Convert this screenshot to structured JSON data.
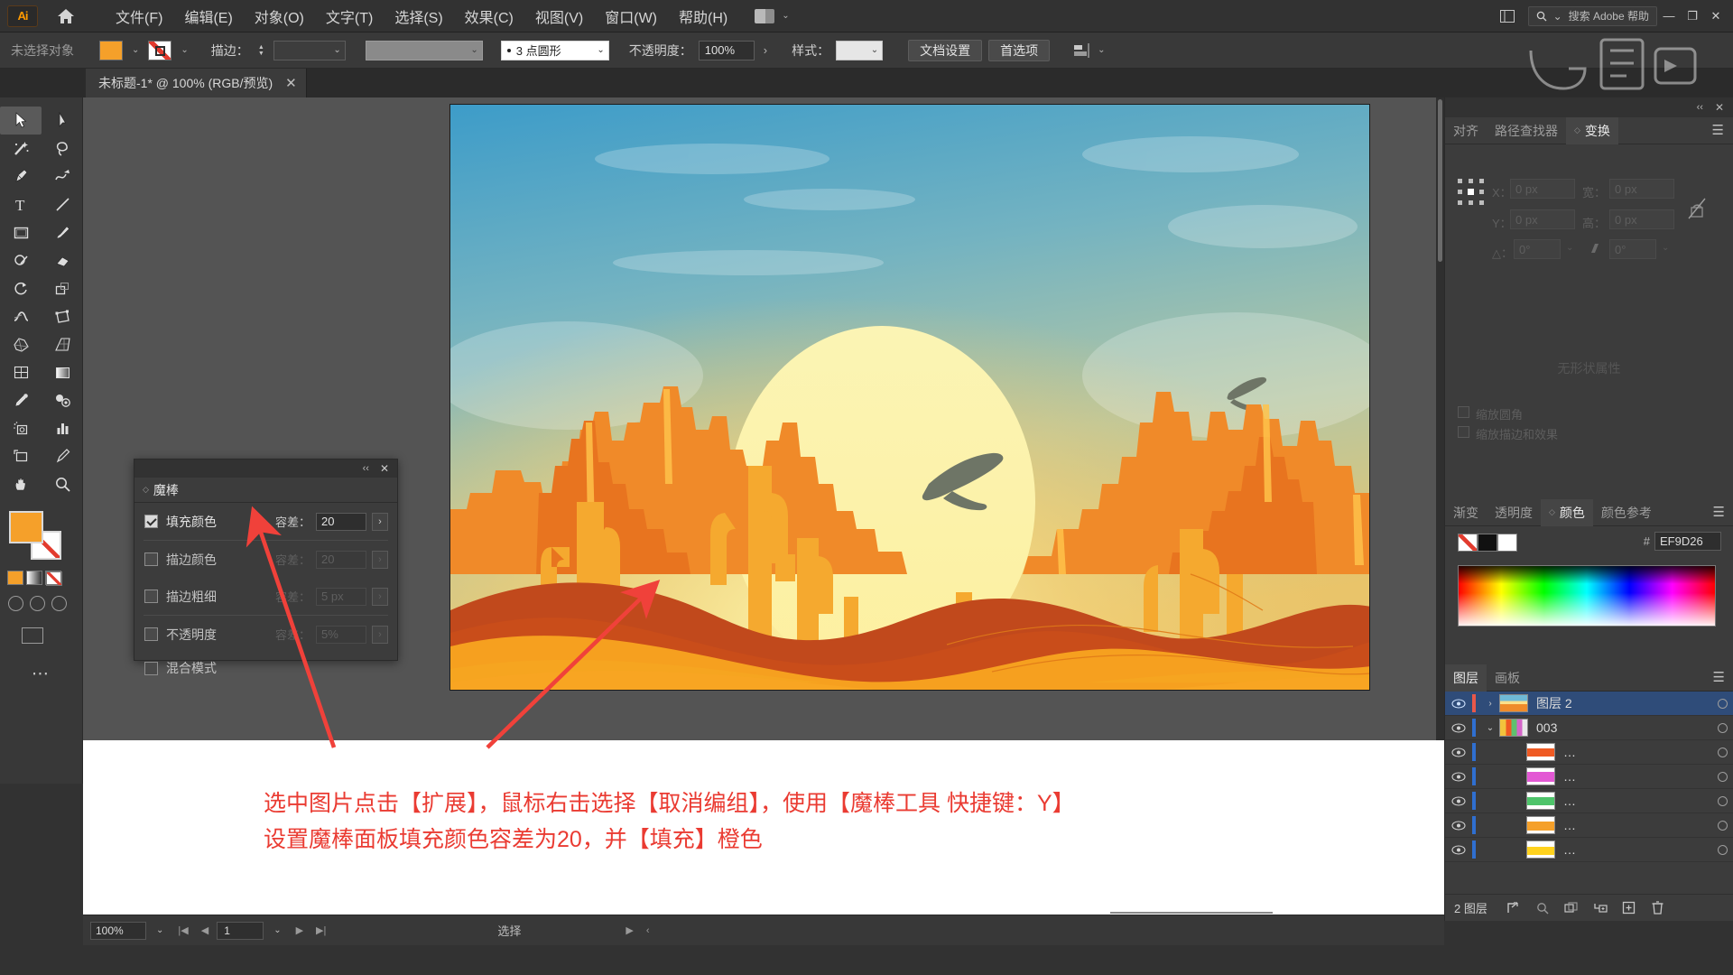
{
  "app": {
    "logo_text": "Ai",
    "menus": [
      "文件(F)",
      "编辑(E)",
      "对象(O)",
      "文字(T)",
      "选择(S)",
      "效果(C)",
      "视图(V)",
      "窗口(W)",
      "帮助(H)"
    ],
    "search_placeholder": "搜索 Adobe 帮助",
    "window_buttons": [
      "—",
      "❐",
      "✕"
    ]
  },
  "options_bar": {
    "selection_status": "未选择对象",
    "fill_color": "#F5A02A",
    "stroke_label": "描边：",
    "stroke_weight": "",
    "brush_profile": "3 点圆形",
    "opacity_label": "不透明度：",
    "opacity_value": "100%",
    "style_label": "样式：",
    "doc_setup_button": "文档设置",
    "preferences_button": "首选项"
  },
  "document_tab": {
    "title": "未标题-1* @ 100% (RGB/预览)",
    "close": "✕"
  },
  "toolbar": {
    "tools": [
      "selection-tool",
      "direct-selection-tool",
      "magic-wand-tool",
      "lasso-tool",
      "pen-tool",
      "curvature-tool",
      "type-tool",
      "line-tool",
      "rectangle-tool",
      "paintbrush-tool",
      "shaper-tool",
      "eraser-tool",
      "rotate-tool",
      "scale-tool",
      "width-tool",
      "free-transform-tool",
      "shape-builder-tool",
      "perspective-grid-tool",
      "mesh-tool",
      "gradient-tool",
      "eyedropper-tool",
      "blend-tool",
      "symbol-sprayer-tool",
      "column-graph-tool",
      "artboard-tool",
      "slice-tool",
      "hand-tool",
      "zoom-tool"
    ],
    "more_tools": "⋯"
  },
  "magic_wand_panel": {
    "panel_title": "魔棒",
    "tolerance_label": "容差：",
    "rows": [
      {
        "label": "填充颜色",
        "checked": true,
        "tolerance": "20",
        "enabled": true
      },
      {
        "label": "描边颜色",
        "checked": false,
        "tolerance": "20",
        "enabled": false
      },
      {
        "label": "描边粗细",
        "checked": false,
        "tolerance": "5 px",
        "enabled": false
      },
      {
        "label": "不透明度",
        "checked": false,
        "tolerance": "5%",
        "enabled": false
      },
      {
        "label": "混合模式",
        "checked": false,
        "tolerance": "",
        "enabled": false
      }
    ]
  },
  "transform_panel": {
    "tabs": [
      {
        "label": "对齐",
        "active": false
      },
      {
        "label": "路径查找器",
        "active": false
      },
      {
        "label": "变换",
        "active": true
      }
    ],
    "fields": {
      "x_label": "X：",
      "x_value": "0 px",
      "y_label": "Y：",
      "y_value": "0 px",
      "w_label": "宽：",
      "w_value": "0 px",
      "h_label": "高：",
      "h_value": "0 px",
      "angle_label": "△：",
      "angle_value": "0°",
      "shear_label": "",
      "shear_value": "0°"
    },
    "checkbox_1": "缩放圆角",
    "checkbox_2": "缩放描边和效果",
    "empty_message": "无形状属性"
  },
  "color_panel": {
    "tabs": [
      {
        "label": "渐变",
        "active": false
      },
      {
        "label": "透明度",
        "active": false
      },
      {
        "label": "颜色",
        "active": true
      },
      {
        "label": "颜色参考",
        "active": false
      }
    ],
    "hex_symbol": "#",
    "hex_value": "EF9D26"
  },
  "layers_panel": {
    "tabs": [
      {
        "label": "图层",
        "active": true
      },
      {
        "label": "画板",
        "active": false
      }
    ],
    "rows": [
      {
        "name": "图层 2",
        "selected": true,
        "indent": 0,
        "expander": "›",
        "color": "#e8584a",
        "thumb": "sunset"
      },
      {
        "name": "003",
        "selected": false,
        "indent": 1,
        "expander": "⌄",
        "color": "#2f6fd0",
        "thumb": "multi"
      },
      {
        "name": "…",
        "selected": false,
        "indent": 2,
        "expander": "",
        "color": "#2f6fd0",
        "thumb": "#ef5a23"
      },
      {
        "name": "…",
        "selected": false,
        "indent": 2,
        "expander": "",
        "color": "#2f6fd0",
        "thumb": "#e358d4"
      },
      {
        "name": "…",
        "selected": false,
        "indent": 2,
        "expander": "",
        "color": "#2f6fd0",
        "thumb": "#4ec46a"
      },
      {
        "name": "…",
        "selected": false,
        "indent": 2,
        "expander": "",
        "color": "#2f6fd0",
        "thumb": "#f5a02a"
      },
      {
        "name": "…",
        "selected": false,
        "indent": 2,
        "expander": "",
        "color": "#2f6fd0",
        "thumb": "#ffd21e"
      }
    ],
    "footer_count": "2 图层",
    "footer_icons": [
      "locate-object-icon",
      "search-icon",
      "make-clipping-mask-icon",
      "create-sublayer-icon",
      "create-new-layer-icon",
      "delete-layer-icon"
    ]
  },
  "annotation": {
    "line1": "选中图片点击【扩展】，鼠标右击选择【取消编组】，使用【魔棒工具 快捷键：Y】",
    "line2": "设置魔棒面板填充颜色容差为20，并【填充】橙色",
    "color": "#EA3B32"
  },
  "status_bar": {
    "zoom": "100%",
    "page": "1",
    "tool_status": "选择"
  },
  "artwork": {
    "description": "desert-sunset-illustration",
    "palette": {
      "sky_top": "#3e9cc9",
      "sky_mid": "#8fc0c0",
      "sky_glow": "#e8c26a",
      "sun": "#f7f0a8",
      "sand_front": "#f6a01f",
      "dune_dark": "#c14a1b",
      "mesa_orange": "#ef7b24",
      "cactus": "#f5a429",
      "bird": "#6e7566"
    }
  }
}
